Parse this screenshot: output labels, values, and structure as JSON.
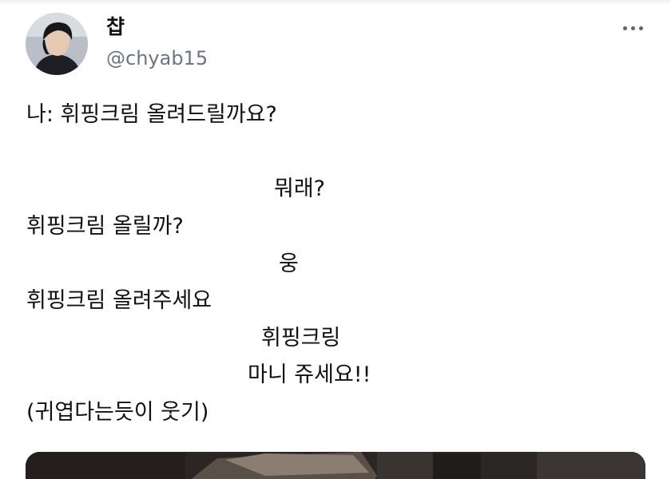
{
  "tweet": {
    "author": {
      "display_name": "챱",
      "handle": "@chyab15",
      "avatar_icon": "profile-photo"
    },
    "more_icon": "more-horizontal-icon",
    "lines": [
      "나: 휘핑크림 올려드릴까요?",
      "뭐래?",
      "휘핑크림 올릴까?",
      "웅",
      "휘핑크림 올려주세요",
      "휘핑크링",
      "마니 쥬세요!!",
      "(귀엽다는듯이 웃기)"
    ]
  }
}
